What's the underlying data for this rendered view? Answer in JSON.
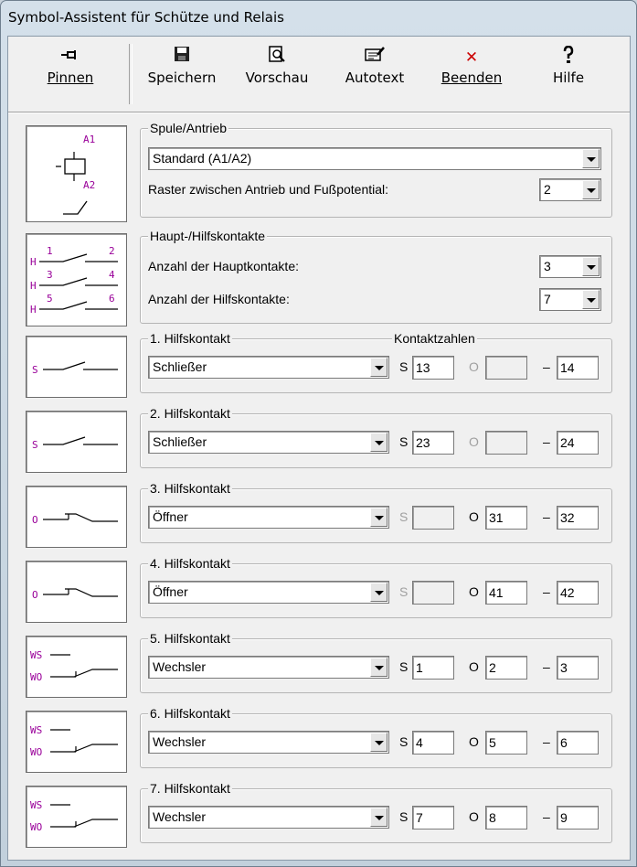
{
  "window": {
    "title": "Symbol-Assistent für Schütze und Relais"
  },
  "toolbar": {
    "pin": {
      "label": "Pinnen",
      "icon": "pin-icon"
    },
    "save": {
      "label": "Speichern",
      "icon": "floppy-disk-icon"
    },
    "preview": {
      "label": "Vorschau",
      "icon": "preview-icon"
    },
    "autotext": {
      "label": "Autotext",
      "icon": "autotext-icon"
    },
    "quit": {
      "label": "Beenden",
      "icon": "close-x-icon",
      "color": "#cc0000"
    },
    "help": {
      "label": "Hilfe",
      "icon": "help-icon"
    }
  },
  "coil": {
    "legend": "Spule/Antrieb",
    "type_value": "Standard (A1/A2)",
    "grid_label": "Raster zwischen Antrieb und Fußpotential:",
    "grid_value": "2",
    "thumb_labels": {
      "a1": "A1",
      "a2": "A2"
    }
  },
  "contacts": {
    "legend": "Haupt-/Hilfskontakte",
    "main_label": "Anzahl der Hauptkontakte:",
    "main_value": "3",
    "aux_label": "Anzahl der Hilfskontakte:",
    "aux_value": "7",
    "thumb_labels": {
      "h": "H",
      "n1": "1",
      "n2": "2",
      "n3": "3",
      "n4": "4",
      "n5": "5",
      "n6": "6"
    }
  },
  "contact_numbers_label": "Kontaktzahlen",
  "aux": [
    {
      "legend": "1. Hilfskontakt",
      "type": "Schließer",
      "kind": "S",
      "s": "13",
      "o": "",
      "end": "14",
      "s_enabled": true,
      "o_enabled": false
    },
    {
      "legend": "2. Hilfskontakt",
      "type": "Schließer",
      "kind": "S",
      "s": "23",
      "o": "",
      "end": "24",
      "s_enabled": true,
      "o_enabled": false
    },
    {
      "legend": "3. Hilfskontakt",
      "type": "Öffner",
      "kind": "O",
      "s": "",
      "o": "31",
      "end": "32",
      "s_enabled": false,
      "o_enabled": true
    },
    {
      "legend": "4. Hilfskontakt",
      "type": "Öffner",
      "kind": "O",
      "s": "",
      "o": "41",
      "end": "42",
      "s_enabled": false,
      "o_enabled": true
    },
    {
      "legend": "5. Hilfskontakt",
      "type": "Wechsler",
      "kind": "W",
      "s": "1",
      "o": "2",
      "end": "3",
      "s_enabled": true,
      "o_enabled": true
    },
    {
      "legend": "6. Hilfskontakt",
      "type": "Wechsler",
      "kind": "W",
      "s": "4",
      "o": "5",
      "end": "6",
      "s_enabled": true,
      "o_enabled": true
    },
    {
      "legend": "7. Hilfskontakt",
      "type": "Wechsler",
      "kind": "W",
      "s": "7",
      "o": "8",
      "end": "9",
      "s_enabled": true,
      "o_enabled": true
    }
  ],
  "labels": {
    "s": "S",
    "o": "O",
    "dash": "–",
    "thumb_s": "S",
    "thumb_o": "O",
    "thumb_ws": "WS",
    "thumb_wo": "WO"
  },
  "colors": {
    "symbol_text": "#990099",
    "symbol_line": "#000000"
  }
}
